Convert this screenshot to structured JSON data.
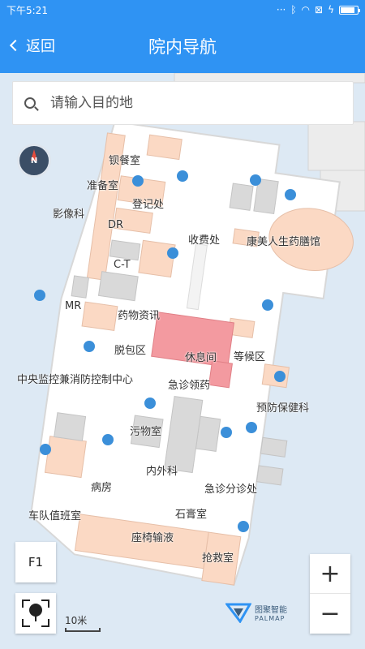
{
  "status": {
    "time": "下午5:21",
    "icons": [
      "signal-dots-icon",
      "bluetooth-icon",
      "wifi-icon",
      "sim-off-icon",
      "charging-icon",
      "battery-icon"
    ],
    "battery_level": 0.85
  },
  "appbar": {
    "back_label": "返回",
    "title": "院内导航",
    "color": "#2f93f3"
  },
  "search": {
    "placeholder": "请输入目的地",
    "value": ""
  },
  "map": {
    "floor": "F1",
    "scale_label": "10米",
    "labels": [
      {
        "id": "dining",
        "text": "钡餐室"
      },
      {
        "id": "prep",
        "text": "准备室"
      },
      {
        "id": "registration",
        "text": "登记处"
      },
      {
        "id": "imaging",
        "text": "影像科"
      },
      {
        "id": "dr",
        "text": "DR"
      },
      {
        "id": "cashier",
        "text": "收费处"
      },
      {
        "id": "pharmacy_shop",
        "text": "康美人生药膳馆"
      },
      {
        "id": "ct",
        "text": "C-T"
      },
      {
        "id": "mr",
        "text": "MR"
      },
      {
        "id": "drug_info",
        "text": "药物资讯"
      },
      {
        "id": "unpack",
        "text": "脱包区"
      },
      {
        "id": "rest",
        "text": "休息间"
      },
      {
        "id": "waiting",
        "text": "等候区"
      },
      {
        "id": "monitor",
        "text": "中央监控兼消防控制中心"
      },
      {
        "id": "er_pharmacy",
        "text": "急诊领药"
      },
      {
        "id": "prevention",
        "text": "预防保健科"
      },
      {
        "id": "dirty",
        "text": "污物室"
      },
      {
        "id": "internal",
        "text": "内外科"
      },
      {
        "id": "ward",
        "text": "病房"
      },
      {
        "id": "triage",
        "text": "急诊分诊处"
      },
      {
        "id": "driver",
        "text": "车队值班室"
      },
      {
        "id": "plaster",
        "text": "石膏室"
      },
      {
        "id": "wheelchair",
        "text": "座椅输液"
      },
      {
        "id": "rescue",
        "text": "抢救室"
      }
    ]
  },
  "controls": {
    "zoom_in": "+",
    "zoom_out": "−"
  },
  "brand": {
    "cn": "图聚智能",
    "en": "PALMAP"
  }
}
